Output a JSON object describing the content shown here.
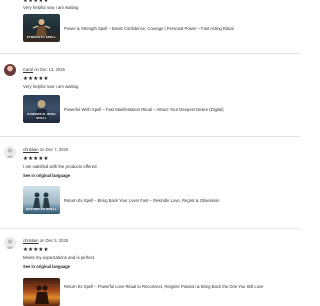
{
  "reviews": [
    {
      "stars": "★★★★★",
      "text": "Very helpful now i am waiting",
      "item": {
        "image_label": "STRENGTH SPELL",
        "title": "Power & Strength Spell – Boost Confidence, Courage | Personal Power – Fast Acting Ritual"
      }
    },
    {
      "reviewer": "Carol",
      "date": "on Dec 13, 2025",
      "stars": "★★★★★",
      "text": "Very helpful now i am waiting",
      "item": {
        "image_label": "POWERFUL WISH SPELL",
        "title": "Powerful Wish Spell – Fast Manifestation Ritual – Attract Your Deepest Desire (Digital)"
      }
    },
    {
      "reviewer": "christian",
      "date": "on Dec 7, 2025",
      "stars": "★★★★★",
      "text": "I am satisfied with the products offered.",
      "see_original": "See in original language",
      "item": {
        "image_label": "RETURN EX SPELL",
        "title": "Return Ex Spell – Bring Back Your Lover Fast – Rekindle Love, Regret & Obsession"
      }
    },
    {
      "reviewer": "christian",
      "date": "on Dec 5, 2025",
      "stars": "★★★★★",
      "text": "Meets my expectations and is perfect.",
      "see_original": "See in original language",
      "item": {
        "image_label": "",
        "title": "Return Ex Spell – Powerful Love Ritual to Reconnect, Reignite Passion & Bring Back the One You Still Love"
      }
    }
  ]
}
